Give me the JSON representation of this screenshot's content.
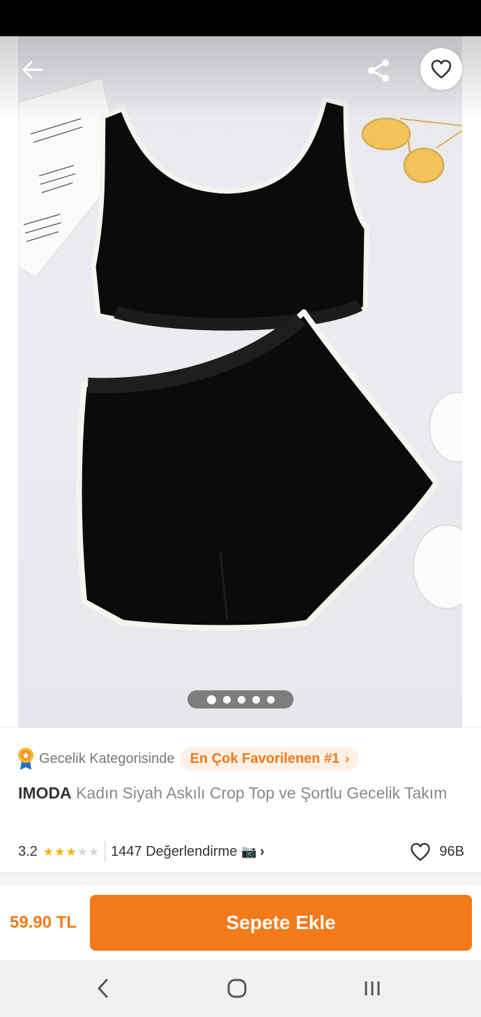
{
  "colors": {
    "accent": "#f27a1a",
    "star": "#f2b400"
  },
  "header": {
    "back_icon": "arrow-left-icon",
    "share_icon": "share-icon",
    "favorite_icon": "heart-outline-icon"
  },
  "gallery": {
    "image_count": 5,
    "active_index": 0
  },
  "category": {
    "text": "Gecelik Kategorisinde",
    "badge": "En Çok Favorilenen #1",
    "chevron": "›"
  },
  "product": {
    "brand": "IMODA",
    "name": "Kadın Siyah Askılı Crop Top ve Şortlu Gecelik Takım"
  },
  "rating": {
    "score": "3.2",
    "stars_filled": 3,
    "stars_total": 5,
    "reviews": "1447 Değerlendirme",
    "camera": "📷",
    "chevron": "›"
  },
  "likes": {
    "count": "96B"
  },
  "cart": {
    "price": "59.90 TL",
    "button_label": "Sepete Ekle"
  },
  "system_nav": {
    "back": "‹",
    "home": "○",
    "recents": "|||"
  }
}
